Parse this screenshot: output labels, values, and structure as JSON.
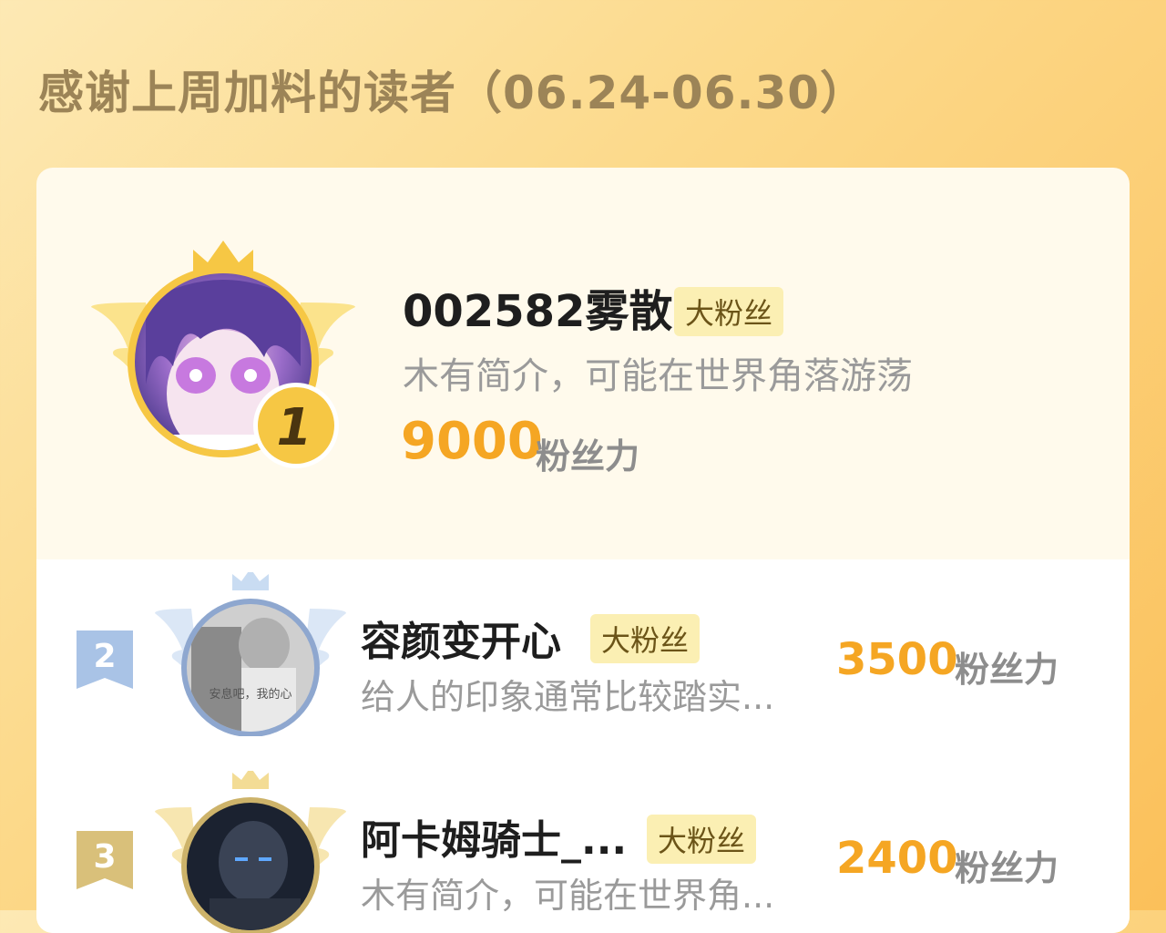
{
  "header": {
    "title": "感谢上周加料的读者（06.24-06.30）"
  },
  "top": {
    "rank": "1",
    "name": "002582雾散",
    "badge": "大粉丝",
    "desc": "木有简介，可能在世界角落游荡",
    "score": "9000",
    "unit": "粉丝力"
  },
  "rows": [
    {
      "rank": "2",
      "name": "容颜变开心",
      "badge": "大粉丝",
      "desc": "给人的印象通常比较踏实...",
      "score": "3500",
      "unit": "粉丝力",
      "avatar_caption": "安息吧，我的心"
    },
    {
      "rank": "3",
      "name": "阿卡姆骑士_...",
      "badge": "大粉丝",
      "desc": "木有简介，可能在世界角...",
      "score": "2400",
      "unit": "粉丝力"
    }
  ],
  "colors": {
    "score": "#f5a623",
    "gold": "#f6c744",
    "silver": "#a9c3e6",
    "bronze": "#d9c07a"
  }
}
